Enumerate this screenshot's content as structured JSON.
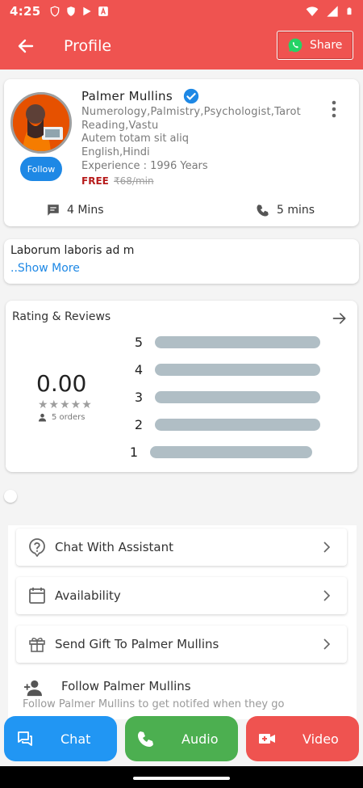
{
  "status_bar": {
    "time": "4:25"
  },
  "app_bar": {
    "title": "Profile",
    "share_label": "Share"
  },
  "profile": {
    "name": "Palmer Mullins",
    "verified": true,
    "skills": "Numerology,Palmistry,Psychologist,Tarot Reading,Vastu",
    "about": "Autem totam sit aliq",
    "languages": "English,Hindi",
    "experience": "Experience : 1996 Years",
    "price_free": "FREE",
    "price_old": "₹68/min",
    "follow_label": "Follow",
    "chat_time": "4 Mins",
    "call_time": "5 mins"
  },
  "bio": {
    "text": "Laborum laboris ad m",
    "show_more": "..Show More"
  },
  "rating": {
    "title": "Rating & Reviews",
    "average": "0.00",
    "stars": "★★★★★",
    "orders": "5 orders",
    "rows": [
      {
        "label": "5",
        "value": 0
      },
      {
        "label": "4",
        "value": 0
      },
      {
        "label": "3",
        "value": 0
      },
      {
        "label": "2",
        "value": 0
      },
      {
        "label": "1",
        "value": 0
      }
    ]
  },
  "menu": {
    "items": [
      {
        "label": "Chat With Assistant",
        "icon": "help-circle-icon"
      },
      {
        "label": "Availability",
        "icon": "calendar-icon"
      },
      {
        "label": "Send Gift To Palmer Mullins",
        "icon": "gift-icon"
      }
    ],
    "follow": {
      "title": "Follow Palmer Mullins",
      "subtitle": "Follow Palmer Mullins to get notifed when they go"
    }
  },
  "actions": {
    "chat": "Chat",
    "audio": "Audio",
    "video": "Video"
  },
  "colors": {
    "primary": "#ef5350",
    "chat": "#2196f3",
    "audio": "#4caf50",
    "link": "#1e88e5"
  }
}
